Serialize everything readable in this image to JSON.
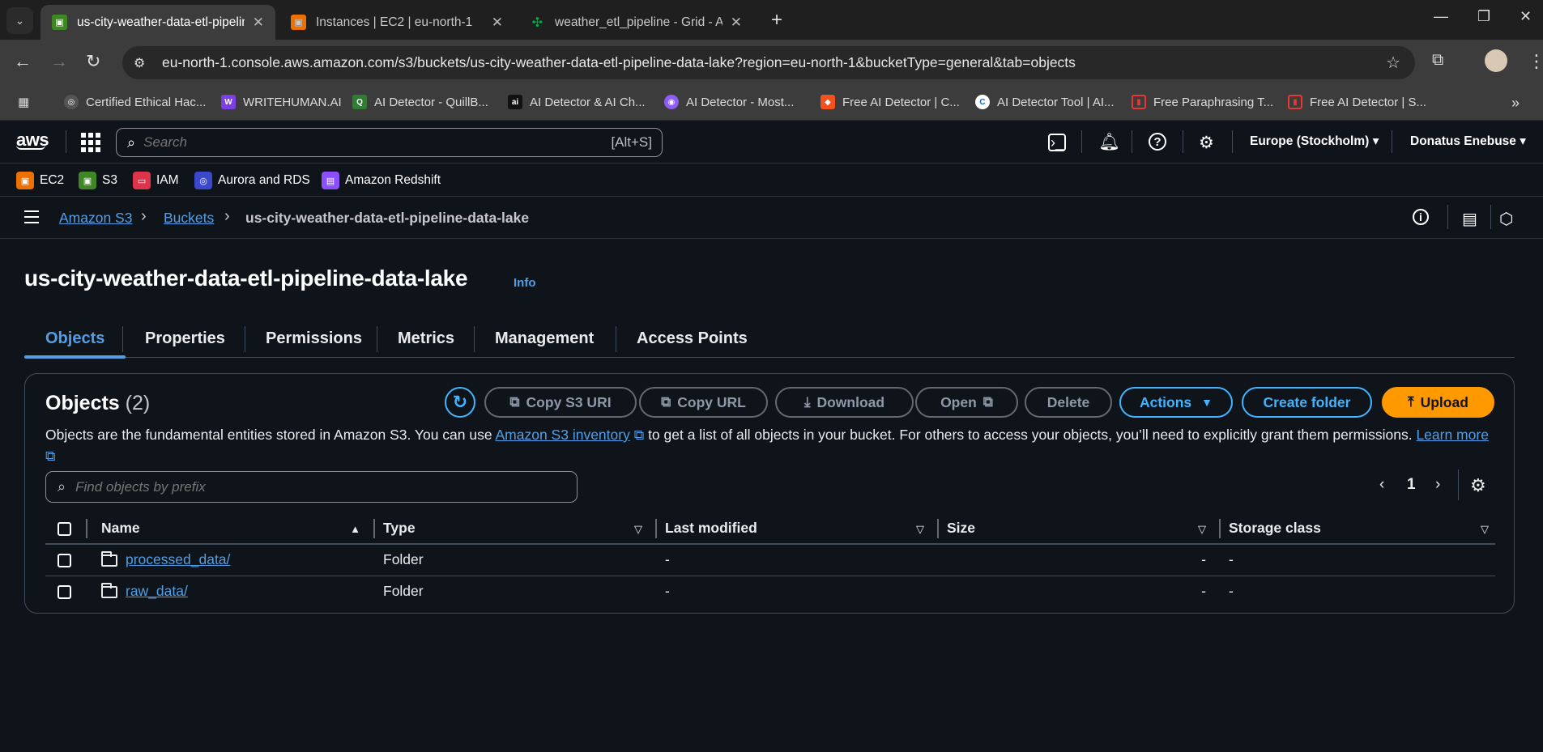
{
  "browser": {
    "tabs": [
      {
        "title": "us-city-weather-data-etl-pipelin",
        "favicon_color": "#3f8624",
        "active": true
      },
      {
        "title": "Instances | EC2 | eu-north-1",
        "favicon_color": "#ed7100",
        "active": false
      },
      {
        "title": "weather_etl_pipeline - Grid - Air",
        "favicon_color": "#00ad46",
        "active": false
      }
    ],
    "url": "eu-north-1.console.aws.amazon.com/s3/buckets/us-city-weather-data-etl-pipeline-data-lake?region=eu-north-1&bucketType=general&tab=objects",
    "bookmarks": [
      {
        "label": "Certified Ethical Hac...",
        "color": "#555555"
      },
      {
        "label": "WRITEHUMAN.AI",
        "color": "#7b3fe4"
      },
      {
        "label": "AI Detector - QuillB...",
        "color": "#2e7d32"
      },
      {
        "label": "AI Detector & AI Ch...",
        "color": "#111111"
      },
      {
        "label": "AI Detector - Most...",
        "color": "#8e5cf7"
      },
      {
        "label": "Free AI Detector | C...",
        "color": "#f4511e"
      },
      {
        "label": "AI Detector Tool | AI...",
        "color": "#1565c0"
      },
      {
        "label": "Free Paraphrasing T...",
        "color": "#e53935"
      },
      {
        "label": "Free AI Detector | S...",
        "color": "#e53935"
      }
    ]
  },
  "aws": {
    "logo": "aws",
    "search_placeholder": "Search",
    "search_hint": "[Alt+S]",
    "region": "Europe (Stockholm)",
    "user": "Donatus Enebuse",
    "services": [
      {
        "label": "EC2",
        "color": "#ed7100"
      },
      {
        "label": "S3",
        "color": "#3f8624"
      },
      {
        "label": "IAM",
        "color": "#dd344c"
      },
      {
        "label": "Aurora and RDS",
        "color": "#3b48cc"
      },
      {
        "label": "Amazon Redshift",
        "color": "#8c4fff"
      }
    ]
  },
  "breadcrumb": {
    "root": "Amazon S3",
    "buckets": "Buckets",
    "current": "us-city-weather-data-etl-pipeline-data-lake"
  },
  "page": {
    "title": "us-city-weather-data-etl-pipeline-data-lake",
    "info": "Info",
    "tabs": [
      "Objects",
      "Properties",
      "Permissions",
      "Metrics",
      "Management",
      "Access Points"
    ]
  },
  "objects": {
    "heading": "Objects",
    "count": "(2)",
    "buttons": {
      "copy_s3_uri": "Copy S3 URI",
      "copy_url": "Copy URL",
      "download": "Download",
      "open": "Open",
      "delete": "Delete",
      "actions": "Actions",
      "create_folder": "Create folder",
      "upload": "Upload"
    },
    "desc_before": "Objects are the fundamental entities stored in Amazon S3. You can use ",
    "desc_link": "Amazon S3 inventory",
    "desc_after": " to get a list of all objects in your bucket. For others to access your objects, you’ll need to explicitly grant them permissions. ",
    "learn_more": "Learn more",
    "filter_placeholder": "Find objects by prefix",
    "page_number": "1",
    "columns": [
      "Name",
      "Type",
      "Last modified",
      "Size",
      "Storage class"
    ],
    "rows": [
      {
        "name": "processed_data/",
        "type": "Folder",
        "last_modified": "-",
        "size": "-",
        "storage_class": "-"
      },
      {
        "name": "raw_data/",
        "type": "Folder",
        "last_modified": "-",
        "size": "-",
        "storage_class": "-"
      }
    ]
  }
}
